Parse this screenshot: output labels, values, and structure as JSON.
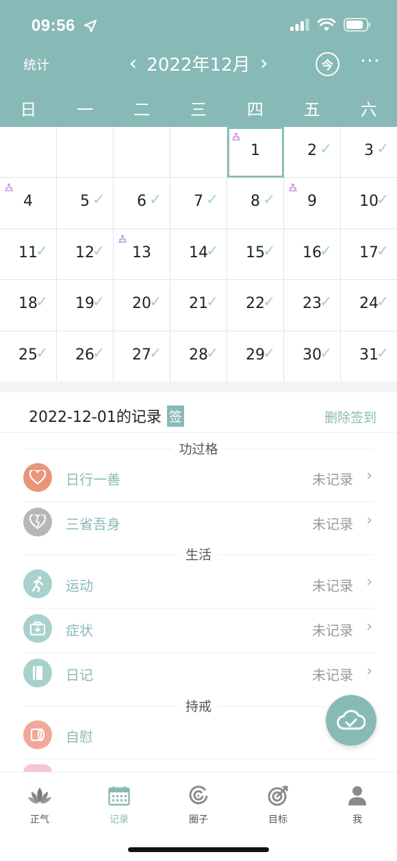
{
  "status_bar": {
    "time": "09:56"
  },
  "header": {
    "left_label": "统计",
    "month": "2022年12月",
    "today_label": "今",
    "more_label": "···"
  },
  "weekdays": [
    "日",
    "一",
    "二",
    "三",
    "四",
    "五",
    "六"
  ],
  "calendar": {
    "rows": [
      [
        {
          "d": ""
        },
        {
          "d": ""
        },
        {
          "d": ""
        },
        {
          "d": ""
        },
        {
          "d": "1",
          "lotus": true,
          "selected": true
        },
        {
          "d": "2",
          "check": true
        },
        {
          "d": "3",
          "check": true
        }
      ],
      [
        {
          "d": "4",
          "lotus": true
        },
        {
          "d": "5",
          "check": true
        },
        {
          "d": "6",
          "check": true
        },
        {
          "d": "7",
          "check": true
        },
        {
          "d": "8",
          "check": true
        },
        {
          "d": "9",
          "lotus": true
        },
        {
          "d": "10",
          "check": true
        }
      ],
      [
        {
          "d": "11",
          "check": true
        },
        {
          "d": "12",
          "check": true
        },
        {
          "d": "13",
          "lotus": true
        },
        {
          "d": "14",
          "check": true
        },
        {
          "d": "15",
          "check": true
        },
        {
          "d": "16",
          "check": true
        },
        {
          "d": "17",
          "check": true
        }
      ],
      [
        {
          "d": "18",
          "check": true
        },
        {
          "d": "19",
          "check": true
        },
        {
          "d": "20",
          "check": true
        },
        {
          "d": "21",
          "check": true
        },
        {
          "d": "22",
          "check": true
        },
        {
          "d": "23",
          "check": true
        },
        {
          "d": "24",
          "check": true
        }
      ],
      [
        {
          "d": "25",
          "check": true
        },
        {
          "d": "26",
          "check": true
        },
        {
          "d": "27",
          "check": true
        },
        {
          "d": "28",
          "check": true
        },
        {
          "d": "29",
          "check": true
        },
        {
          "d": "30",
          "check": true
        },
        {
          "d": "31",
          "check": true
        }
      ]
    ]
  },
  "record": {
    "title": "2022-12-01的记录",
    "tag": "签",
    "delete_label": "删除签到"
  },
  "sections": {
    "merit": "功过格",
    "life": "生活",
    "precepts": "持戒"
  },
  "items": {
    "good_deed": {
      "label": "日行一善",
      "value": "未记录",
      "color": "#e8957c"
    },
    "reflect": {
      "label": "三省吾身",
      "value": "未记录",
      "color": "#b7b7b7"
    },
    "exercise": {
      "label": "运动",
      "value": "未记录",
      "color": "#a9d1cc"
    },
    "symptom": {
      "label": "症状",
      "value": "未记录",
      "color": "#a9d1cc"
    },
    "diary": {
      "label": "日记",
      "value": "未记录",
      "color": "#a9d1cc"
    },
    "self": {
      "label": "自慰",
      "value": "",
      "color": "#f2a79a"
    }
  },
  "tabs": [
    {
      "label": "正气"
    },
    {
      "label": "记录"
    },
    {
      "label": "圈子"
    },
    {
      "label": "目标"
    },
    {
      "label": "我"
    }
  ],
  "colors": {
    "accent": "#87bab6"
  }
}
